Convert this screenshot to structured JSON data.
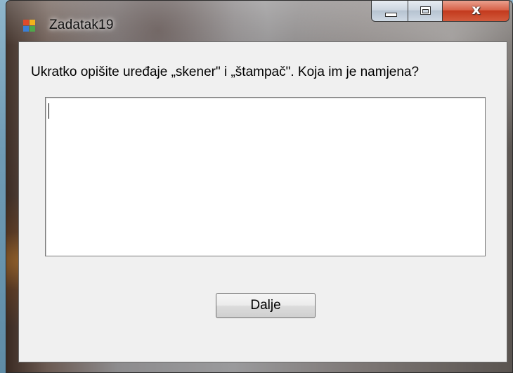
{
  "window": {
    "title": "Zadatak19",
    "controls": {
      "minimize": "minimize",
      "maximize": "maximize",
      "close_glyph": "x"
    }
  },
  "form": {
    "question": "Ukratko opišite uređaje „skener\" i „štampač\". Koja im je namjena?",
    "answer_value": "",
    "next_button_label": "Dalje"
  },
  "icons": {
    "app": "windows-form-icon",
    "minimize": "minimize-icon",
    "maximize": "maximize-icon",
    "close": "close-icon"
  },
  "colors": {
    "client_background": "#f0f0f0",
    "close_button": "#c33a1e",
    "caption_buttons": "#cdd6e0"
  }
}
